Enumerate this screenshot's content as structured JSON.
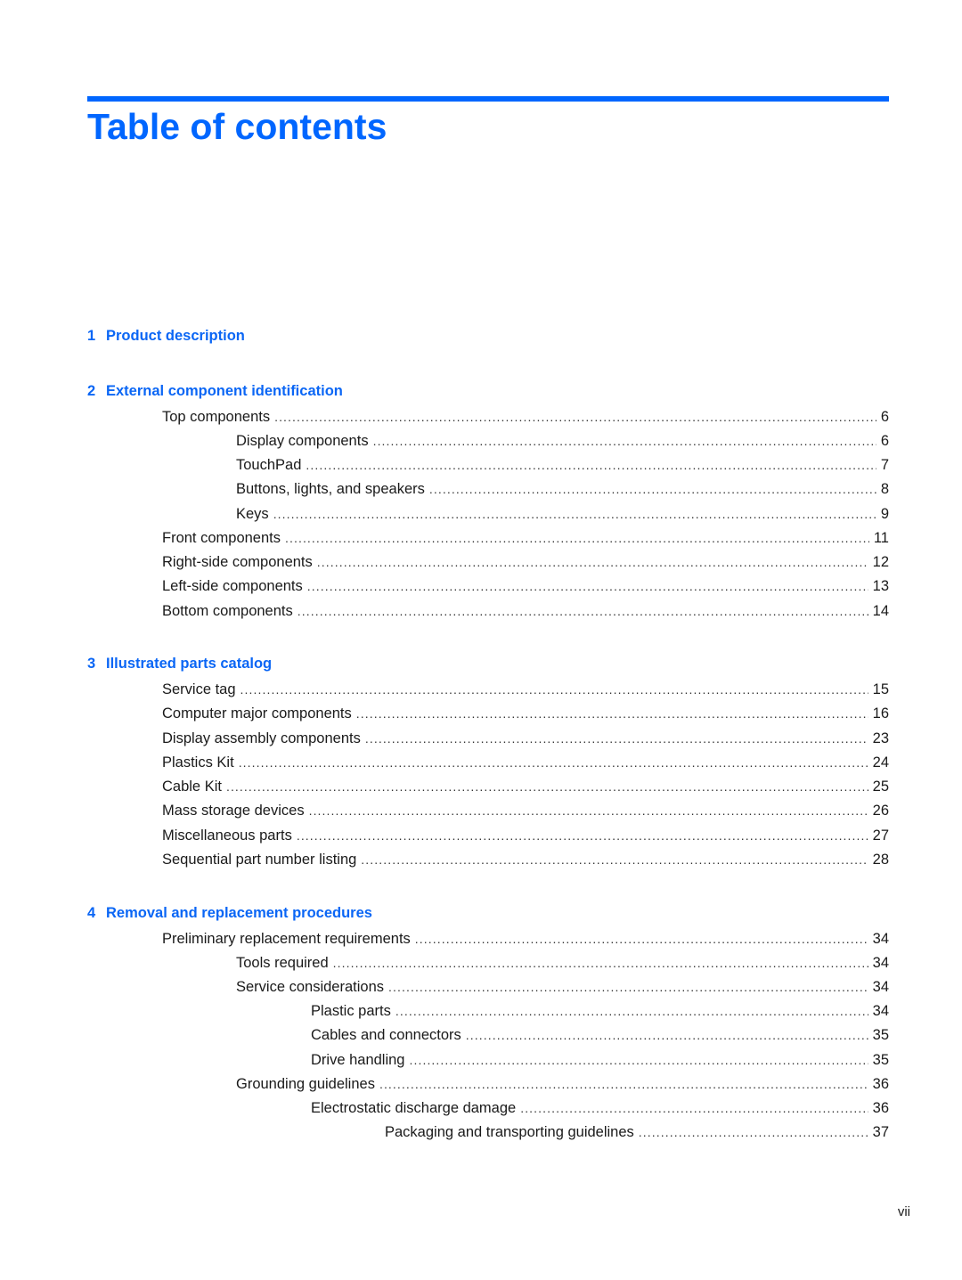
{
  "title": "Table of contents",
  "accent_color": "#0066ff",
  "chapters": [
    {
      "number": "1",
      "title": "Product description",
      "entries": []
    },
    {
      "number": "2",
      "title": "External component identification",
      "entries": [
        {
          "level": 1,
          "label": "Top components",
          "page": "6"
        },
        {
          "level": 2,
          "label": "Display components",
          "page": "6"
        },
        {
          "level": 2,
          "label": "TouchPad",
          "page": "7"
        },
        {
          "level": 2,
          "label": "Buttons, lights, and speakers",
          "page": "8"
        },
        {
          "level": 2,
          "label": "Keys",
          "page": "9"
        },
        {
          "level": 1,
          "label": "Front components",
          "page": "11"
        },
        {
          "level": 1,
          "label": "Right-side components",
          "page": "12"
        },
        {
          "level": 1,
          "label": "Left-side components",
          "page": "13"
        },
        {
          "level": 1,
          "label": "Bottom components",
          "page": "14"
        }
      ]
    },
    {
      "number": "3",
      "title": "Illustrated parts catalog",
      "entries": [
        {
          "level": 1,
          "label": "Service tag",
          "page": "15"
        },
        {
          "level": 1,
          "label": "Computer major components",
          "page": "16"
        },
        {
          "level": 1,
          "label": "Display assembly components",
          "page": "23"
        },
        {
          "level": 1,
          "label": "Plastics Kit",
          "page": "24"
        },
        {
          "level": 1,
          "label": "Cable Kit",
          "page": "25"
        },
        {
          "level": 1,
          "label": "Mass storage devices",
          "page": "26"
        },
        {
          "level": 1,
          "label": "Miscellaneous parts",
          "page": "27"
        },
        {
          "level": 1,
          "label": "Sequential part number listing",
          "page": "28"
        }
      ]
    },
    {
      "number": "4",
      "title": "Removal and replacement procedures",
      "entries": [
        {
          "level": 1,
          "label": "Preliminary replacement requirements",
          "page": "34"
        },
        {
          "level": 2,
          "label": "Tools required",
          "page": "34"
        },
        {
          "level": 2,
          "label": "Service considerations",
          "page": "34"
        },
        {
          "level": 3,
          "label": "Plastic parts",
          "page": "34"
        },
        {
          "level": 3,
          "label": "Cables and connectors",
          "page": "35"
        },
        {
          "level": 3,
          "label": "Drive handling",
          "page": "35"
        },
        {
          "level": 2,
          "label": "Grounding guidelines",
          "page": "36"
        },
        {
          "level": 3,
          "label": "Electrostatic discharge damage",
          "page": "36"
        },
        {
          "level": 4,
          "label": "Packaging and transporting guidelines",
          "page": "37"
        }
      ]
    }
  ],
  "footer": {
    "page_number": "vii"
  }
}
